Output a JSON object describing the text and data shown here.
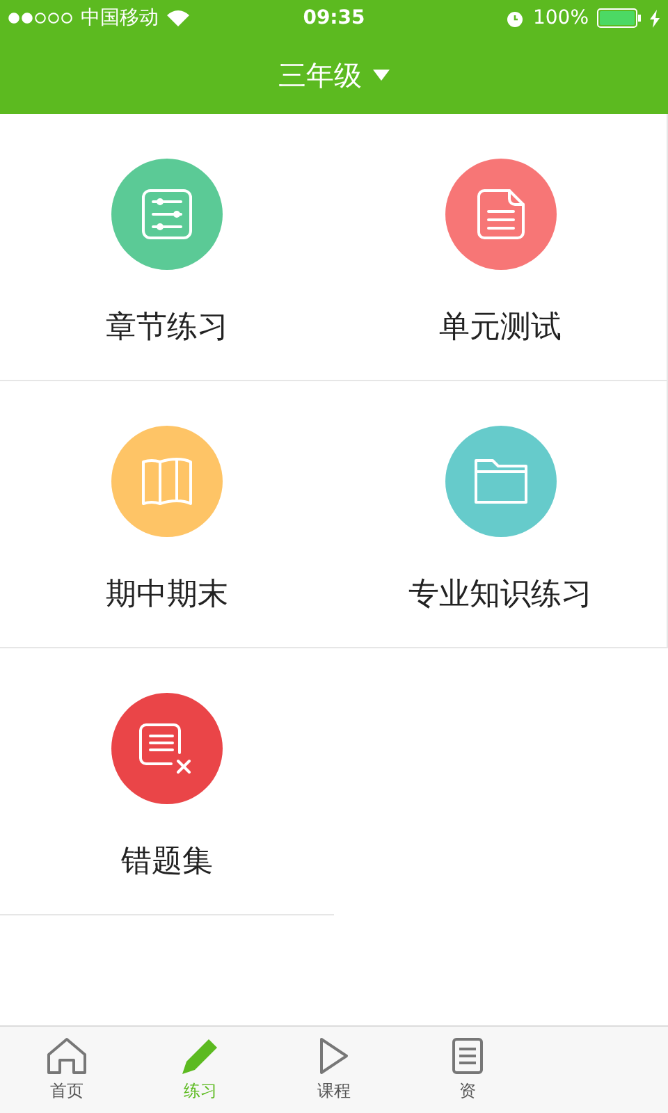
{
  "status_bar": {
    "carrier": "中国移动",
    "time": "09:35",
    "battery": "100%"
  },
  "nav": {
    "title": "三年级"
  },
  "tiles": [
    {
      "label": "章节练习",
      "kind": "sliders",
      "color": "#5bca96"
    },
    {
      "label": "单元测试",
      "kind": "document",
      "color": "#f77676"
    },
    {
      "label": "期中期末",
      "kind": "map",
      "color": "#fec466"
    },
    {
      "label": "专业知识练习",
      "kind": "folder",
      "color": "#66cbcb"
    },
    {
      "label": "错题集",
      "kind": "mistakes",
      "color": "#ea4548"
    }
  ],
  "tab_bar": [
    {
      "label": "首页",
      "kind": "home",
      "selected": false
    },
    {
      "label": "练习",
      "kind": "pencil",
      "selected": true
    },
    {
      "label": "课程",
      "kind": "play",
      "selected": false
    },
    {
      "label": "资",
      "kind": "list",
      "selected": false
    }
  ]
}
